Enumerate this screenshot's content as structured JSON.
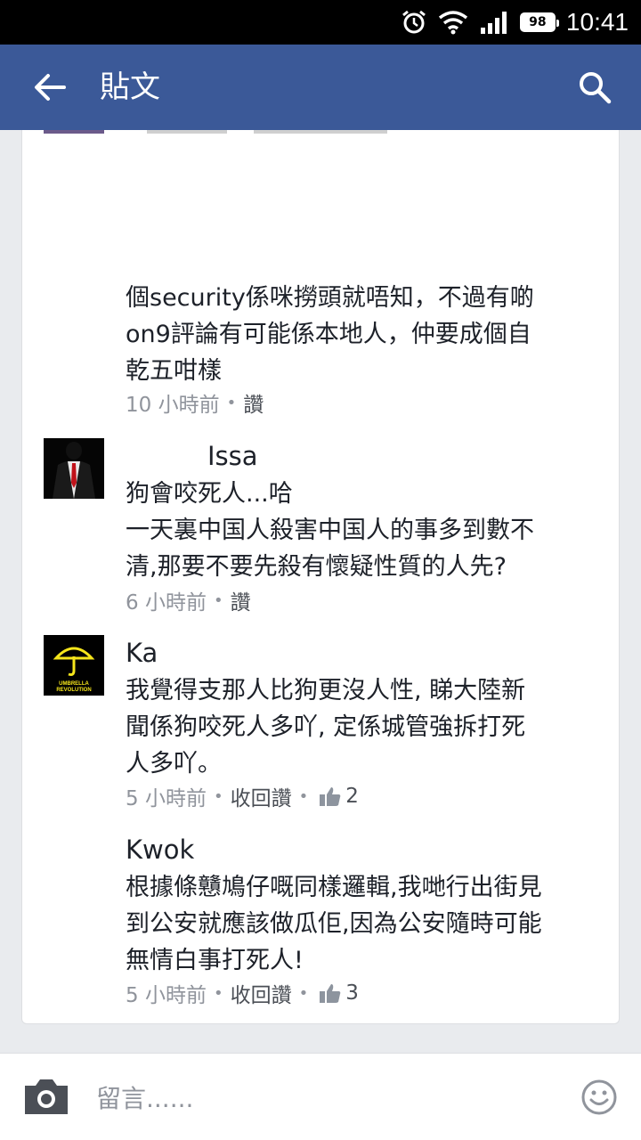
{
  "status_bar": {
    "battery": "98",
    "time": "10:41"
  },
  "app_bar": {
    "title": "貼文"
  },
  "comments": [
    {
      "text_lines": [
        "個security係咪撈頭就唔知，不過有啲",
        "on9評論有可能係本地人，仲要成個自",
        "乾五咁樣"
      ],
      "time": "10 小時前",
      "action": "讚"
    },
    {
      "author": "Issa",
      "text_lines": [
        "狗會咬死人...哈",
        "一天裏中国人殺害中国人的事多到數不",
        "清,那要不要先殺有懷疑性質的人先?"
      ],
      "time": "6 小時前",
      "action": "讚"
    },
    {
      "author": "Ka",
      "avatar_text": [
        "UMBRELLA",
        "REVOLUTION"
      ],
      "text_lines": [
        "我覺得支那人比狗更沒人性, 睇大陸新",
        "聞係狗咬死人多吖, 定係城管強拆打死",
        "人多吖。"
      ],
      "time": "5 小時前",
      "action": "收回讚",
      "likes": "2"
    },
    {
      "author": "Kwok",
      "text_lines": [
        "根據條戇鳩仔嘅同樣邏輯,我哋行出街見",
        "到公安就應該做瓜佢,因為公安隨時可能",
        "無情白事打死人!"
      ],
      "time": "5 小時前",
      "action": "收回讚",
      "likes": "3"
    }
  ],
  "composer": {
    "placeholder": "留言......"
  },
  "colors": {
    "brand": "#3b5998",
    "meta": "#90949c",
    "umbrella_yellow": "#f5e51b"
  }
}
